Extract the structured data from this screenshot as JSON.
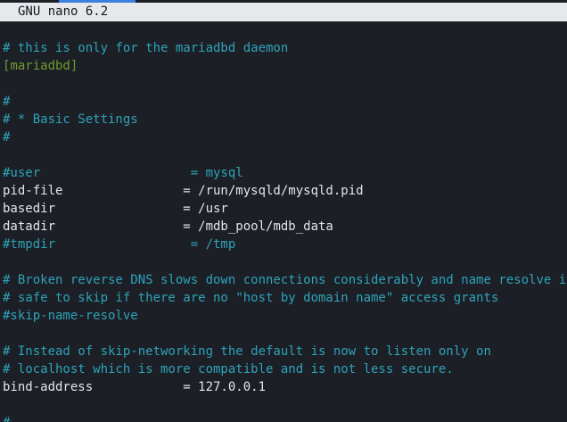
{
  "titlebar": {
    "title": "GNU nano 6.2"
  },
  "colors": {
    "background": "#1c1f26",
    "titlebar_bg": "#e6e8ec",
    "comment": "#2ea3b8",
    "section": "#6f9a2e",
    "text": "#e3e5ea",
    "tab_accent": "#3d7fe0"
  },
  "lines": [
    {
      "type": "comment",
      "text": "# this is only for the mariadbd daemon"
    },
    {
      "type": "section",
      "text": "[mariadbd]"
    },
    {
      "type": "blank",
      "text": ""
    },
    {
      "type": "comment",
      "text": "#"
    },
    {
      "type": "comment",
      "text": "# * Basic Settings"
    },
    {
      "type": "comment",
      "text": "#"
    },
    {
      "type": "blank",
      "text": ""
    },
    {
      "type": "comment",
      "text": "#user                    = mysql"
    },
    {
      "type": "setting",
      "text": "pid-file                = /run/mysqld/mysqld.pid"
    },
    {
      "type": "setting",
      "text": "basedir                 = /usr"
    },
    {
      "type": "setting",
      "text": "datadir                 = /mdb_pool/mdb_data"
    },
    {
      "type": "comment",
      "text": "#tmpdir                  = /tmp"
    },
    {
      "type": "blank",
      "text": ""
    },
    {
      "type": "comment",
      "text": "# Broken reverse DNS slows down connections considerably and name resolve is"
    },
    {
      "type": "comment",
      "text": "# safe to skip if there are no \"host by domain name\" access grants"
    },
    {
      "type": "comment",
      "text": "#skip-name-resolve"
    },
    {
      "type": "blank",
      "text": ""
    },
    {
      "type": "comment",
      "text": "# Instead of skip-networking the default is now to listen only on"
    },
    {
      "type": "comment",
      "text": "# localhost which is more compatible and is not less secure."
    },
    {
      "type": "setting",
      "text": "bind-address            = 127.0.0.1"
    },
    {
      "type": "blank",
      "text": ""
    },
    {
      "type": "comment",
      "text": "#"
    }
  ]
}
